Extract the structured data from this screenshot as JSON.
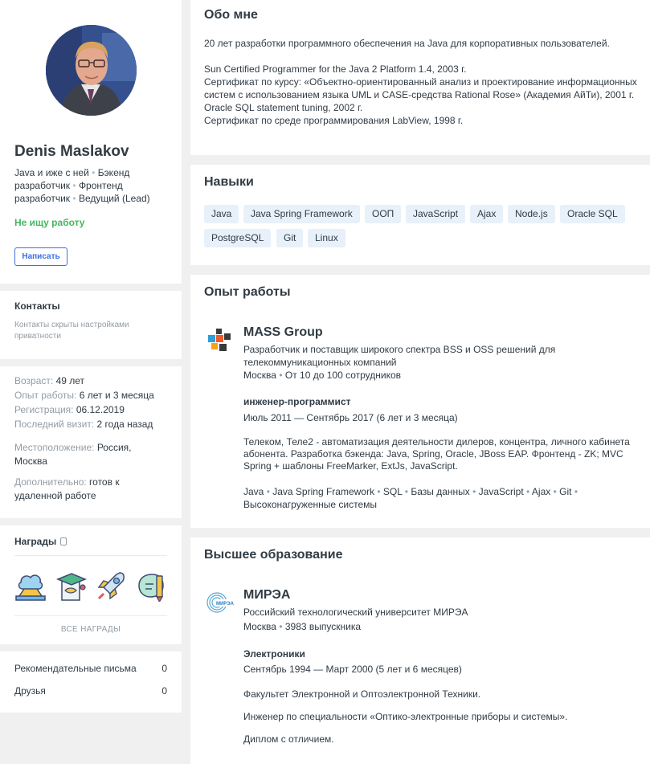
{
  "profile": {
    "name": "Denis Maslakov",
    "specs": [
      "Java и иже с ней",
      "Бэкенд разработчик",
      "Фронтенд разработчик",
      "Ведущий (Lead)"
    ],
    "status": "Не ищу работу",
    "write_label": "Написать"
  },
  "contacts": {
    "title": "Контакты",
    "text": "Контакты скрыты настройками приватности"
  },
  "facts": {
    "age_label": "Возраст:",
    "age": "49 лет",
    "exp_label": "Опыт работы:",
    "exp": "6 лет и 3 месяца",
    "reg_label": "Регистрация:",
    "reg": "06.12.2019",
    "visit_label": "Последний визит:",
    "visit": "2 года назад",
    "loc_label": "Местоположение:",
    "loc": "Россия, Москва",
    "extra_label": "Дополнительно:",
    "extra": "готов к удаленной работе"
  },
  "awards": {
    "title": "Награды",
    "all_label": "ВСЕ НАГРАДЫ",
    "icons": [
      "cloud-award-icon",
      "book-award-icon",
      "rocket-award-icon",
      "pencil-award-icon"
    ]
  },
  "side_stats": [
    {
      "label": "Рекомендательные письма",
      "value": "0"
    },
    {
      "label": "Друзья",
      "value": "0"
    }
  ],
  "about": {
    "title": "Обо мне",
    "p1": "20 лет разработки программного обеспечения на Java для корпоративных пользователей.",
    "lines": [
      "Sun Certified Programmer for the Java 2 Platform 1.4, 2003 г.",
      "Сертификат по курсу: «Объектно-ориентированный анализ и проектирование информационных систем с использованием языка UML и CASE-средства Rational Rose» (Академия АйТи), 2001 г.",
      "Oracle SQL statement tuning, 2002 г.",
      "Сертификат по среде программирования LabView, 1998 г."
    ]
  },
  "skills": {
    "title": "Навыки",
    "items": [
      "Java",
      "Java Spring Framework",
      "ООП",
      "JavaScript",
      "Ajax",
      "Node.js",
      "Oracle SQL",
      "PostgreSQL",
      "Git",
      "Linux"
    ]
  },
  "experience": {
    "title": "Опыт работы",
    "company": "MASS Group",
    "company_desc": "Разработчик и поставщик широкого спектра BSS и OSS решений для телекоммуникационных компаний",
    "city": "Москва",
    "size": "От 10 до 100 сотрудников",
    "position": "инженер-программист",
    "period": "Июль 2011 — Сентябрь 2017 (6 лет и 3 месяца)",
    "description": "Телеком, Теле2 - автоматизация деятельности дилеров, концентра, личного кабинета абонента. Разработка бэкенда: Java, Spring, Oracle, JBoss EAP. Фронтенд - ZK; MVC Spring + шаблоны FreeMarker, ExtJs, JavaScript.",
    "tags": [
      "Java",
      "Java Spring Framework",
      "SQL",
      "Базы данных",
      "JavaScript",
      "Ajax",
      "Git",
      "Высоконагруженные системы"
    ]
  },
  "education": {
    "title": "Высшее образование",
    "name": "МИРЭА",
    "logo_text": "МИРЭА",
    "full_name": "Российский технологический университет МИРЭА",
    "city": "Москва",
    "grads": "3983 выпускника",
    "faculty": "Электроники",
    "period": "Сентябрь 1994 — Март 2000 (5 лет и 6 месяцев)",
    "p1": "Факультет Электронной и Оптоэлектронной Техники.",
    "p2": "Инженер по специальности «Оптико-электронные приборы и системы».",
    "p3": "Диплом с отличием."
  }
}
